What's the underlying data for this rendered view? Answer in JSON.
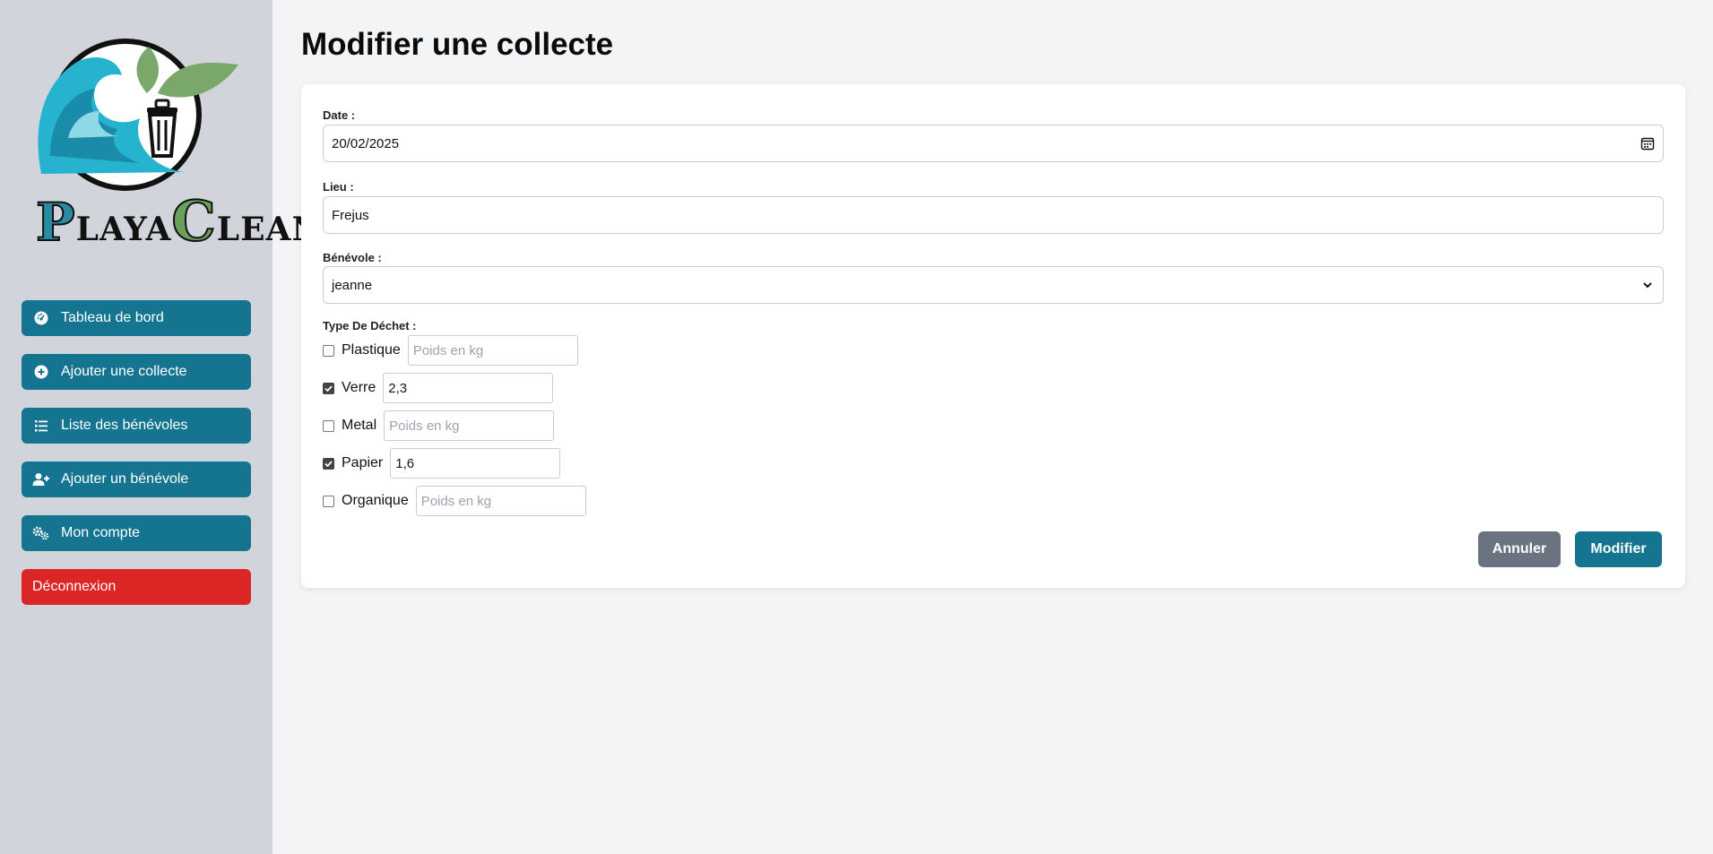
{
  "sidebar": {
    "logo": {
      "first": "P",
      "middle1": "LAYA",
      "second": "C",
      "middle2": "LEAN"
    },
    "items": [
      {
        "label": "Tableau de bord",
        "icon": "dashboard-icon"
      },
      {
        "label": "Ajouter une collecte",
        "icon": "plus-circle-icon"
      },
      {
        "label": "Liste des bénévoles",
        "icon": "list-icon"
      },
      {
        "label": "Ajouter un bénévole",
        "icon": "user-plus-icon"
      },
      {
        "label": "Mon compte",
        "icon": "gears-icon"
      },
      {
        "label": "Déconnexion",
        "icon": ""
      }
    ]
  },
  "page": {
    "title": "Modifier une collecte"
  },
  "form": {
    "date": {
      "label": "Date :",
      "value": "20/02/2025"
    },
    "lieu": {
      "label": "Lieu :",
      "value": "Frejus"
    },
    "benevole": {
      "label": "Bénévole :",
      "value": "jeanne"
    },
    "waste": {
      "label": "Type De Déchet :",
      "placeholder": "Poids en kg",
      "items": [
        {
          "name": "Plastique",
          "checked": false,
          "value": ""
        },
        {
          "name": "Verre",
          "checked": true,
          "value": "2,3"
        },
        {
          "name": "Metal",
          "checked": false,
          "value": ""
        },
        {
          "name": "Papier",
          "checked": true,
          "value": "1,6"
        },
        {
          "name": "Organique",
          "checked": false,
          "value": ""
        }
      ]
    },
    "cancel_label": "Annuler",
    "submit_label": "Modifier"
  },
  "colors": {
    "primary": "#157591",
    "danger": "#dc2626",
    "secondary": "#6b7280",
    "sidebar_bg": "#d1d5db",
    "page_bg": "#f3f4f6"
  }
}
